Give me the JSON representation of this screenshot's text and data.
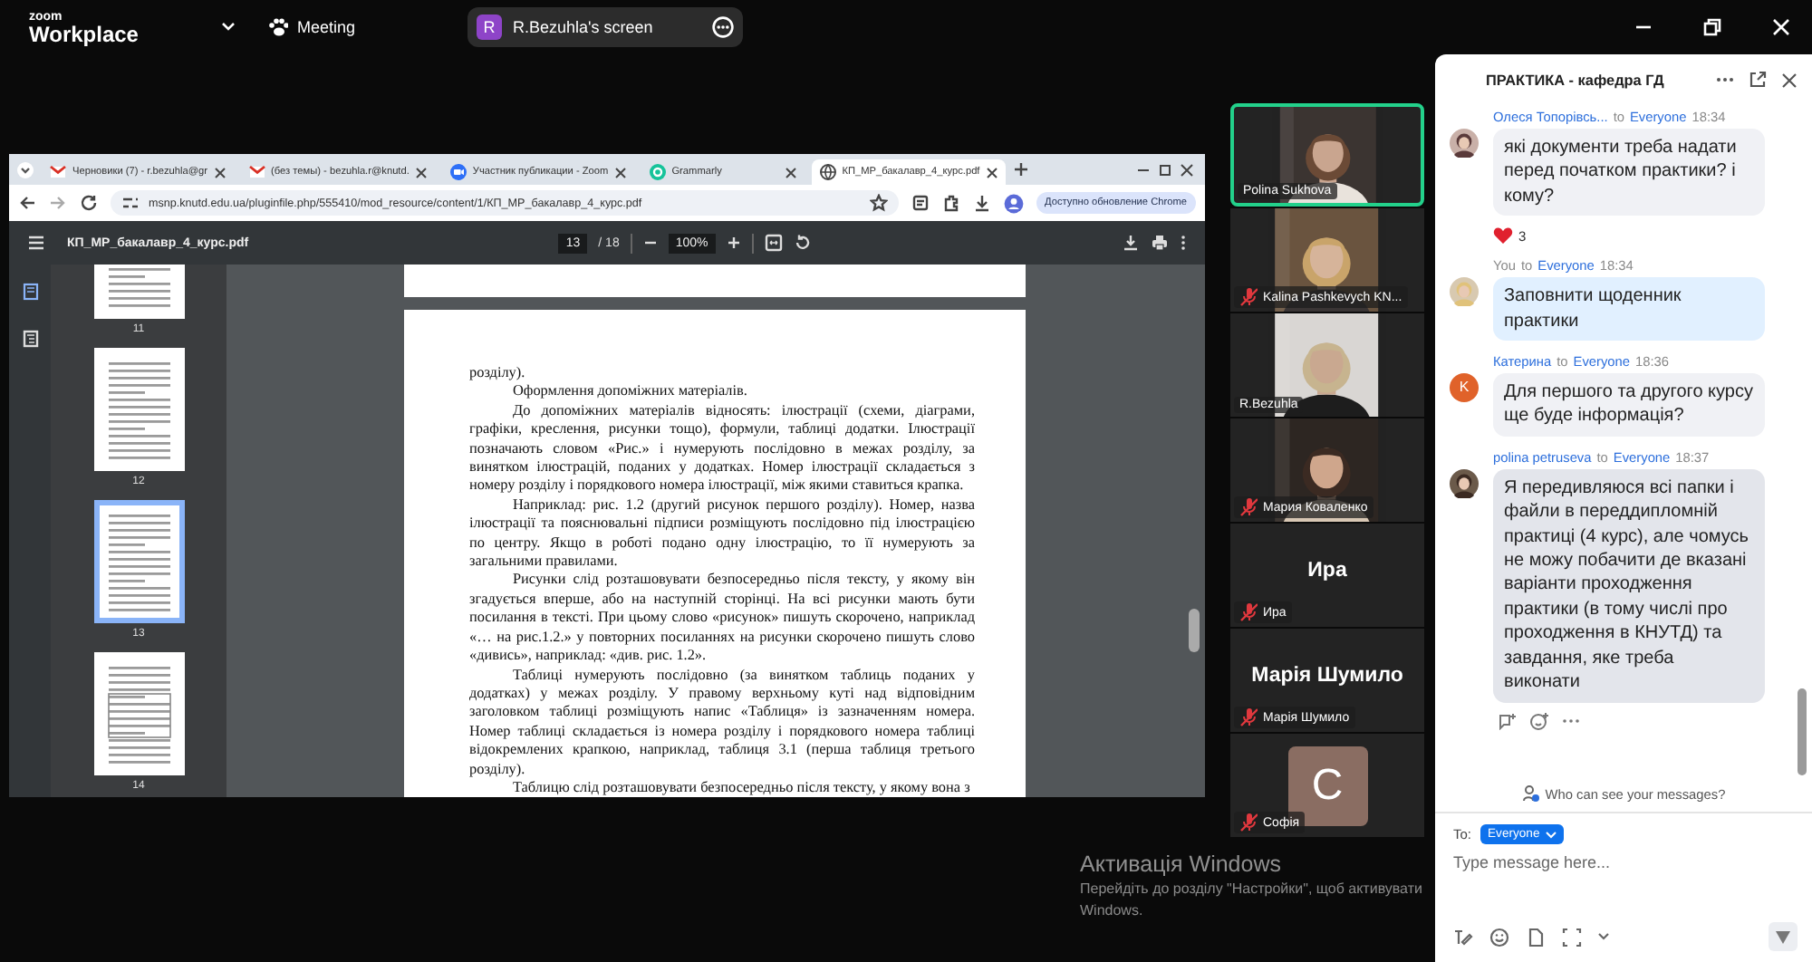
{
  "top_bar": {
    "brand": "zoom",
    "product": "Workplace",
    "meeting": "Meeting",
    "share": {
      "initial": "R",
      "label": "R.Bezuhla's screen"
    }
  },
  "browser": {
    "tabs": [
      {
        "title": "Черновики (7) - r.bezuhla@gr",
        "selected": false
      },
      {
        "title": "(без темы) - bezuhla.r@knutd.",
        "selected": false
      },
      {
        "title": "Участник публикации - Zoom",
        "selected": false
      },
      {
        "title": "Grammarly",
        "selected": false
      },
      {
        "title": "КП_МР_бакалавр_4_курс.pdf",
        "selected": true
      }
    ],
    "url": "msnp.knutd.edu.ua/pluginfile.php/555410/mod_resource/content/1/КП_МР_бакалавр_4_курс.pdf",
    "update_button": "Доступно обновление Chrome"
  },
  "pdf_viewer": {
    "file_name": "КП_МР_бакалавр_4_курс.pdf",
    "page": "13",
    "page_total": "/ 18",
    "zoom": "100%",
    "thumbnails": [
      {
        "label": "11",
        "selected": false
      },
      {
        "label": "12",
        "selected": false
      },
      {
        "label": "13",
        "selected": true
      },
      {
        "label": "14",
        "selected": false
      }
    ],
    "paragraphs": [
      {
        "text": "розділу).",
        "indent": false
      },
      {
        "text": "Оформлення допоміжних матеріалів.",
        "indent": true
      },
      {
        "text": "До допоміжних матеріалів відносять: ілюстрації (схеми, діаграми, графіки, креслення, рисунки тощо), формули, таблиці додатки. Ілюстрації позначають словом «Рис.» і нумерують послідовно в межах розділу, за винятком ілюстрацій, поданих у додатках. Номер ілюстрації складається з номеру розділу і порядкового номера ілюстрації, між якими ставиться крапка.",
        "indent": true
      },
      {
        "text": "Наприклад: рис. 1.2 (другий рисунок першого розділу). Номер, назва ілюстрації та пояснювальні підписи розміщують послідовно під ілюстрацією по центру. Якщо в роботі подано одну ілюстрацію, то її нумерують за загальними правилами.",
        "indent": true
      },
      {
        "text": "Рисунки слід розташовувати безпосередньо після тексту, у якому він згадується вперше, або на наступній сторінці. На всі рисунки мають бути посилання в тексті. При цьому слово «рисунок» пишуть скорочено, наприклад «… на рис.1.2.» у повторних посиланнях на рисунки скорочено пишуть слово «дивись», наприклад: «див. рис. 1.2».",
        "indent": true
      },
      {
        "text": "Таблиці нумерують послідовно (за винятком таблиць поданих у додатках) у межах розділу. У правому верхньому куті над відповідним заголовком таблиці розміщують напис «Таблиця» із зазначенням номера. Номер таблиці складається із номера розділу і порядкового номера таблиці відокремлених крапкою, наприклад, таблиця 3.1 (перша таблиця третього розділу).",
        "indent": true
      },
      {
        "text": "Таблицю слід розташовувати безпосередньо після тексту, у якому вона з",
        "indent": true
      }
    ]
  },
  "participants": [
    {
      "name": "Polina Sukhova",
      "kind": "video",
      "muted": false,
      "speaking": true
    },
    {
      "name": "Kalina Pashkevych KN...",
      "kind": "video",
      "muted": true,
      "speaking": false
    },
    {
      "name": "R.Bezuhla",
      "kind": "video",
      "muted": false,
      "speaking": false
    },
    {
      "name": "Мария Коваленко",
      "kind": "video",
      "muted": true,
      "speaking": false
    },
    {
      "name": "Ира",
      "kind": "name",
      "display": "Ира",
      "muted": true,
      "speaking": false
    },
    {
      "name": "Марія Шумило",
      "kind": "name",
      "display": "Марія Шумило",
      "muted": true,
      "speaking": false
    },
    {
      "name": "Софія",
      "kind": "avatar",
      "initial": "C",
      "muted": true,
      "speaking": false
    }
  ],
  "chat": {
    "title": "ПРАКТИКА - кафедра ГД",
    "messages": [
      {
        "sender": "Олеся Топорівсь...",
        "to": "to",
        "recipient": "Everyone",
        "time": "18:34",
        "text": "які документи треба надати перед початком практики? і кому?",
        "mine": false,
        "reaction_count": "3",
        "actions": false
      },
      {
        "sender": "You",
        "to": "to",
        "recipient": "Everyone",
        "time": "18:34",
        "text": "Заповнити щоденник практики",
        "mine": true,
        "actions": false
      },
      {
        "sender": "Катерина",
        "to": "to",
        "recipient": "Everyone",
        "time": "18:36",
        "text": "Для першого та другого курсу ще буде інформація?",
        "initial": "K",
        "color": "#e0622a",
        "mine": false,
        "actions": false
      },
      {
        "sender": "polina petruseva",
        "to": "to",
        "recipient": "Everyone",
        "time": "18:37",
        "text": "Я передивляюся всі папки і файли в переддипломній практиці (4 курс), але чомусь не можу побачити де вказані варіанти проходження практики (в тому числі про проходження в КНУТД) та завдання, яке треба виконати",
        "mine": false,
        "actions": true
      }
    ],
    "privacy_note": "Who can see your messages?",
    "to_label": "To:",
    "recipient_button": "Everyone",
    "placeholder": "Type message here..."
  },
  "os_notice": {
    "title": "Активація Windows",
    "text_lines": [
      "Перейдіть до розділу \"Настройки\", щоб активувати",
      "Windows."
    ]
  }
}
